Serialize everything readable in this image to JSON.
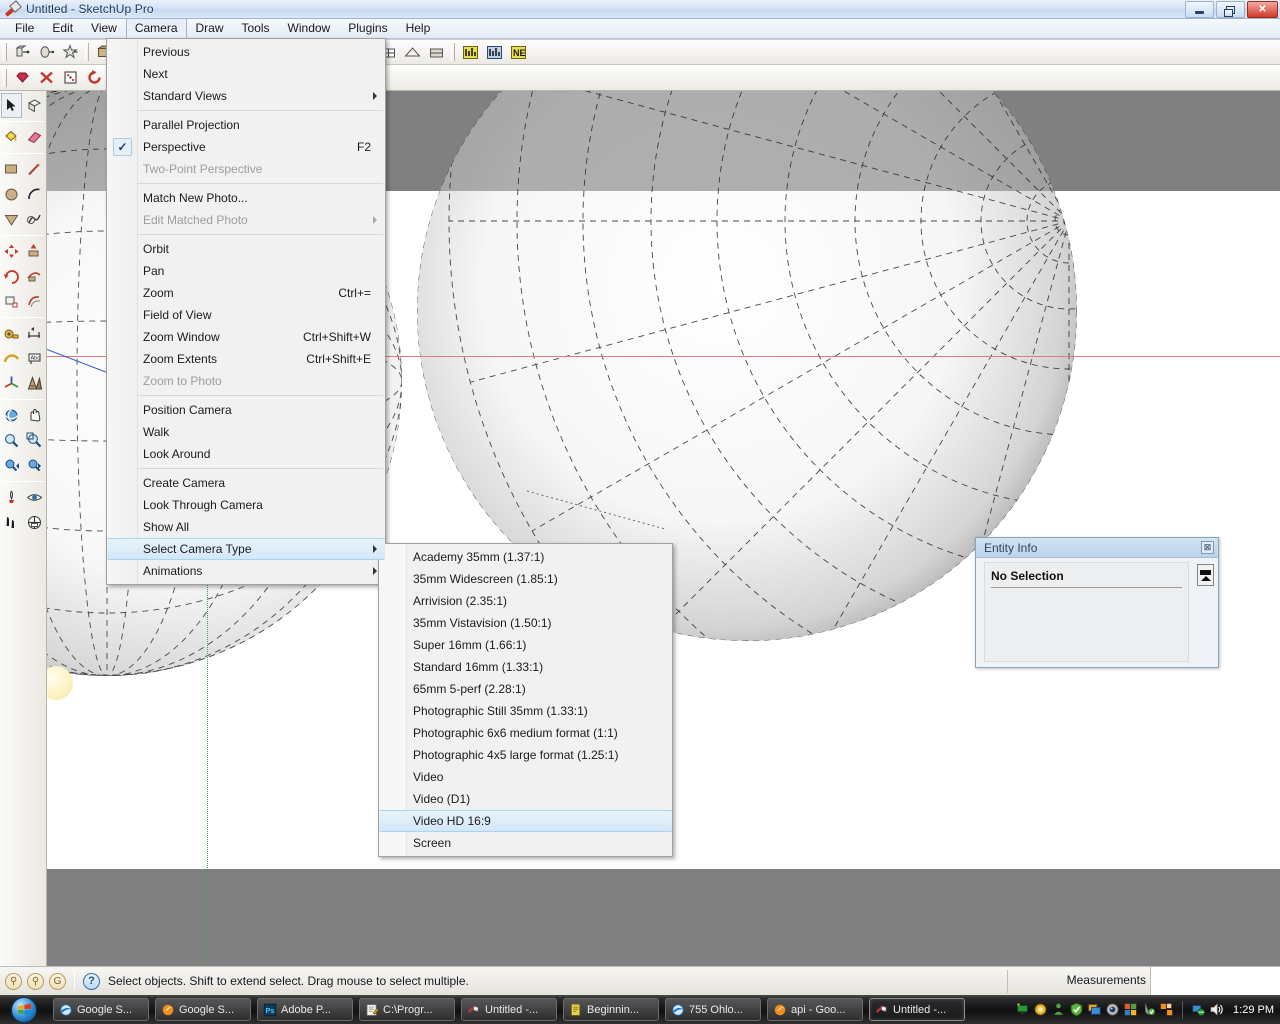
{
  "window": {
    "title": "Untitled - SketchUp Pro",
    "app_icon": "sketchup-logo-icon",
    "controls": {
      "minimize": "minimize-button",
      "maximize": "maximize-button",
      "close": "close-button",
      "close_glyph": "✕"
    }
  },
  "menubar": {
    "items": [
      {
        "label": "File",
        "open": false
      },
      {
        "label": "Edit",
        "open": false
      },
      {
        "label": "View",
        "open": false
      },
      {
        "label": "Camera",
        "open": true
      },
      {
        "label": "Draw",
        "open": false
      },
      {
        "label": "Tools",
        "open": false
      },
      {
        "label": "Window",
        "open": false
      },
      {
        "label": "Plugins",
        "open": false
      },
      {
        "label": "Help",
        "open": false
      }
    ]
  },
  "camera_menu": {
    "items": [
      {
        "label": "Previous",
        "accel": "",
        "disabled": false,
        "submenu": false,
        "checked": false
      },
      {
        "label": "Next",
        "accel": "",
        "disabled": false,
        "submenu": false,
        "checked": false
      },
      {
        "label": "Standard Views",
        "accel": "",
        "disabled": false,
        "submenu": true,
        "checked": false
      },
      {
        "separator": true
      },
      {
        "label": "Parallel Projection",
        "accel": "",
        "disabled": false,
        "submenu": false,
        "checked": false
      },
      {
        "label": "Perspective",
        "accel": "F2",
        "disabled": false,
        "submenu": false,
        "checked": true
      },
      {
        "label": "Two-Point Perspective",
        "accel": "",
        "disabled": true,
        "submenu": false,
        "checked": false
      },
      {
        "separator": true
      },
      {
        "label": "Match New Photo...",
        "accel": "",
        "disabled": false,
        "submenu": false,
        "checked": false
      },
      {
        "label": "Edit Matched Photo",
        "accel": "",
        "disabled": true,
        "submenu": true,
        "checked": false
      },
      {
        "separator": true
      },
      {
        "label": "Orbit",
        "accel": "",
        "disabled": false,
        "submenu": false,
        "checked": false
      },
      {
        "label": "Pan",
        "accel": "",
        "disabled": false,
        "submenu": false,
        "checked": false
      },
      {
        "label": "Zoom",
        "accel": "Ctrl+=",
        "disabled": false,
        "submenu": false,
        "checked": false
      },
      {
        "label": "Field of View",
        "accel": "",
        "disabled": false,
        "submenu": false,
        "checked": false
      },
      {
        "label": "Zoom Window",
        "accel": "Ctrl+Shift+W",
        "disabled": false,
        "submenu": false,
        "checked": false
      },
      {
        "label": "Zoom Extents",
        "accel": "Ctrl+Shift+E",
        "disabled": false,
        "submenu": false,
        "checked": false
      },
      {
        "label": "Zoom to Photo",
        "accel": "",
        "disabled": true,
        "submenu": false,
        "checked": false
      },
      {
        "separator": true
      },
      {
        "label": "Position Camera",
        "accel": "",
        "disabled": false,
        "submenu": false,
        "checked": false
      },
      {
        "label": "Walk",
        "accel": "",
        "disabled": false,
        "submenu": false,
        "checked": false
      },
      {
        "label": "Look Around",
        "accel": "",
        "disabled": false,
        "submenu": false,
        "checked": false
      },
      {
        "separator": true
      },
      {
        "label": "Create Camera",
        "accel": "",
        "disabled": false,
        "submenu": false,
        "checked": false
      },
      {
        "label": "Look Through Camera",
        "accel": "",
        "disabled": false,
        "submenu": false,
        "checked": false
      },
      {
        "label": "Show All",
        "accel": "",
        "disabled": false,
        "submenu": false,
        "checked": false
      },
      {
        "label": "Select Camera Type",
        "accel": "",
        "disabled": false,
        "submenu": true,
        "checked": false,
        "highlighted": true
      },
      {
        "label": "Animations",
        "accel": "",
        "disabled": false,
        "submenu": true,
        "checked": false
      }
    ],
    "checkmark_glyph": "✓"
  },
  "camera_type_submenu": {
    "items": [
      {
        "label": "Academy 35mm (1.37:1)"
      },
      {
        "label": "35mm Widescreen (1.85:1)"
      },
      {
        "label": "Arrivision (2.35:1)"
      },
      {
        "label": "35mm Vistavision (1.50:1)"
      },
      {
        "label": "Super 16mm (1.66:1)"
      },
      {
        "label": "Standard 16mm (1.33:1)"
      },
      {
        "label": "65mm 5-perf (2.28:1)"
      },
      {
        "label": "Photographic Still 35mm (1.33:1)"
      },
      {
        "label": "Photographic 6x6 medium format (1:1)"
      },
      {
        "label": "Photographic 4x5 large format (1.25:1)"
      },
      {
        "label": "Video"
      },
      {
        "label": "Video (D1)"
      },
      {
        "label": "Video HD 16:9",
        "highlighted": true
      },
      {
        "label": "Screen"
      }
    ]
  },
  "entity_info": {
    "title": "Entity Info",
    "status": "No Selection",
    "close_glyph": "⊠",
    "close_name": "entity-info-close-icon",
    "expand_name": "entity-info-expand-button"
  },
  "statusbar": {
    "icons": [
      "privacy-person-icon",
      "credits-person-icon",
      "geo-g-icon"
    ],
    "help_glyph": "?",
    "message": "Select objects. Shift to extend select. Drag mouse to select multiple.",
    "measurements_label": "Measurements",
    "measurements_value": ""
  },
  "taskbar": {
    "start_label": "",
    "tasks": [
      {
        "label": "Google S...",
        "icon": "internet-explorer-icon",
        "active": false
      },
      {
        "label": "Google S...",
        "icon": "firefox-icon",
        "active": false
      },
      {
        "label": "Adobe P...",
        "icon": "photoshop-icon",
        "active": false
      },
      {
        "label": "C:\\Progr...",
        "icon": "notepad-icon",
        "active": false
      },
      {
        "label": "Untitled -...",
        "icon": "sketchup-icon",
        "active": false
      },
      {
        "label": "Beginnin...",
        "icon": "document-icon",
        "active": false
      },
      {
        "label": "755 Ohlo...",
        "icon": "internet-explorer-icon",
        "active": false
      },
      {
        "label": "api - Goo...",
        "icon": "firefox-icon",
        "active": false
      },
      {
        "label": "Untitled -...",
        "icon": "sketchup-icon",
        "active": true
      }
    ],
    "tray": [
      "network-monitor-icon",
      "orange-circle-icon",
      "green-person-icon",
      "shield-check-icon",
      "blue-window-icon",
      "webcam-icon",
      "office-icon",
      "antivirus-icon",
      "orange-blocks-icon"
    ],
    "tray2": [
      "network-globe-icon",
      "volume-icon"
    ],
    "clock": "1:29 PM"
  },
  "toolbar1": {
    "groups": [
      {
        "buttons": [
          "component-icon",
          "dynamic-component-icon",
          "interact-icon"
        ]
      },
      {
        "buttons": [
          "materials-icon",
          "rotated-rect-icon",
          "texture-icon",
          "paint-icon"
        ]
      },
      {
        "buttons": [
          "photo-match-icon",
          "shadow-icon",
          "fog-icon",
          "clip-icon"
        ]
      },
      {
        "buttons": [
          "house-icon",
          "door-icon",
          "home-icon",
          "window-icon",
          "roof-icon",
          "wall-icon"
        ]
      },
      {
        "buttons": [
          "graph-yellow-icon",
          "graph-blue-icon",
          "ne-icon"
        ]
      }
    ]
  },
  "toolbar2": {
    "groups": [
      {
        "buttons": [
          "ruby-gem-icon",
          "red-x-icon",
          "dice-icon",
          "refresh-icon",
          "yellow-bar-icon"
        ]
      }
    ]
  },
  "tool_palette": {
    "groups": [
      {
        "tools": [
          {
            "name": "select-tool",
            "selected": true
          },
          {
            "name": "make-component-tool",
            "selected": false
          }
        ]
      },
      {
        "tools": [
          {
            "name": "paint-bucket-tool",
            "selected": false
          },
          {
            "name": "eraser-tool",
            "selected": false
          }
        ]
      },
      {
        "tools": [
          {
            "name": "rectangle-tool",
            "selected": false
          },
          {
            "name": "line-tool",
            "selected": false
          },
          {
            "name": "circle-tool",
            "selected": false
          },
          {
            "name": "arc-tool",
            "selected": false
          },
          {
            "name": "polygon-tool",
            "selected": false
          },
          {
            "name": "freehand-tool",
            "selected": false
          }
        ]
      },
      {
        "tools": [
          {
            "name": "move-tool",
            "selected": false
          },
          {
            "name": "push-pull-tool",
            "selected": false
          },
          {
            "name": "rotate-tool",
            "selected": false
          },
          {
            "name": "follow-me-tool",
            "selected": false
          },
          {
            "name": "scale-tool",
            "selected": false
          },
          {
            "name": "offset-tool",
            "selected": false
          }
        ]
      },
      {
        "tools": [
          {
            "name": "tape-measure-tool",
            "selected": false
          },
          {
            "name": "dimension-tool",
            "selected": false
          },
          {
            "name": "protractor-tool",
            "selected": false
          },
          {
            "name": "text-tool",
            "selected": false
          },
          {
            "name": "axes-tool",
            "selected": false
          },
          {
            "name": "3d-text-tool",
            "selected": false
          }
        ]
      },
      {
        "tools": [
          {
            "name": "orbit-tool",
            "selected": false
          },
          {
            "name": "pan-tool",
            "selected": false
          },
          {
            "name": "zoom-tool",
            "selected": false
          },
          {
            "name": "zoom-window-tool",
            "selected": false
          },
          {
            "name": "previous-view-tool",
            "selected": false
          },
          {
            "name": "next-view-tool",
            "selected": false
          }
        ]
      },
      {
        "tools": [
          {
            "name": "position-camera-tool",
            "selected": false
          },
          {
            "name": "look-around-tool",
            "selected": false
          },
          {
            "name": "walk-tool",
            "selected": false
          },
          {
            "name": "section-plane-tool",
            "selected": false
          }
        ]
      }
    ]
  },
  "viewport": {
    "sky_color": "#808080",
    "ground_color": "#ffffff",
    "lower_band_color": "#808080",
    "green_axis_color": "#4e9e4e",
    "red_axis_color": "#e07b7b",
    "blue_axis_color": "#3a57c8",
    "model_description": "two large shaded spheres with dashed wireframe latitude and longitude lines",
    "sun_label": "sun-sphere"
  }
}
